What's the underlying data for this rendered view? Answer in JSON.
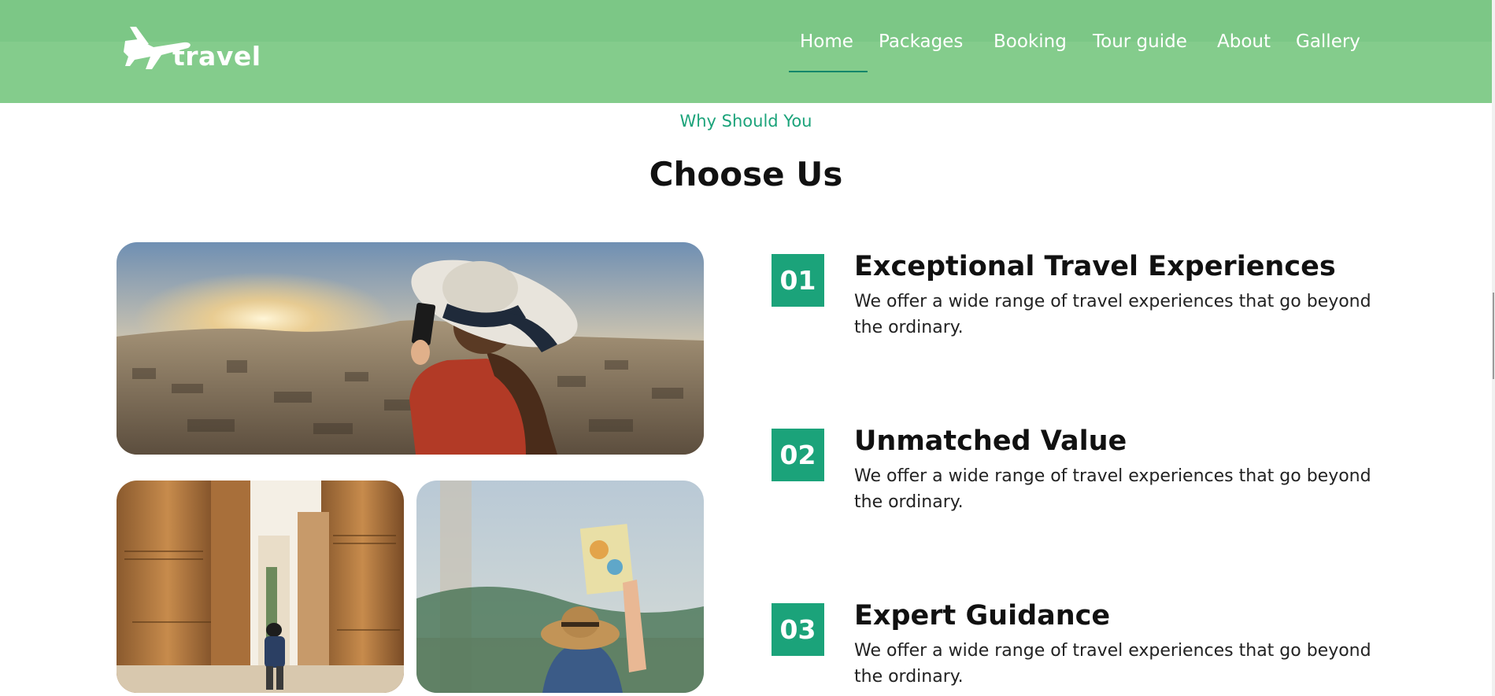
{
  "header": {
    "brand": "travel",
    "logo_icon": "airplane-icon",
    "nav": [
      {
        "label": "Home",
        "active": true
      },
      {
        "label": "Packages"
      },
      {
        "label": "Booking"
      },
      {
        "label": "Tour guide"
      },
      {
        "label": "About"
      },
      {
        "label": "Gallery"
      }
    ]
  },
  "section": {
    "kicker": "Why Should You",
    "title": "Choose Us"
  },
  "features": [
    {
      "number": "01",
      "title": "Exceptional Travel Experiences",
      "desc": "We offer a wide range of travel experiences that go beyond the ordinary."
    },
    {
      "number": "02",
      "title": "Unmatched Value",
      "desc": "We offer a wide range of travel experiences that go beyond the ordinary."
    },
    {
      "number": "03",
      "title": "Expert Guidance",
      "desc": "We offer a wide range of travel experiences that go beyond the ordinary."
    }
  ],
  "colors": {
    "header_bg": "#84cc8c",
    "accent": "#1ba37a",
    "nav_underline": "#14866b"
  }
}
